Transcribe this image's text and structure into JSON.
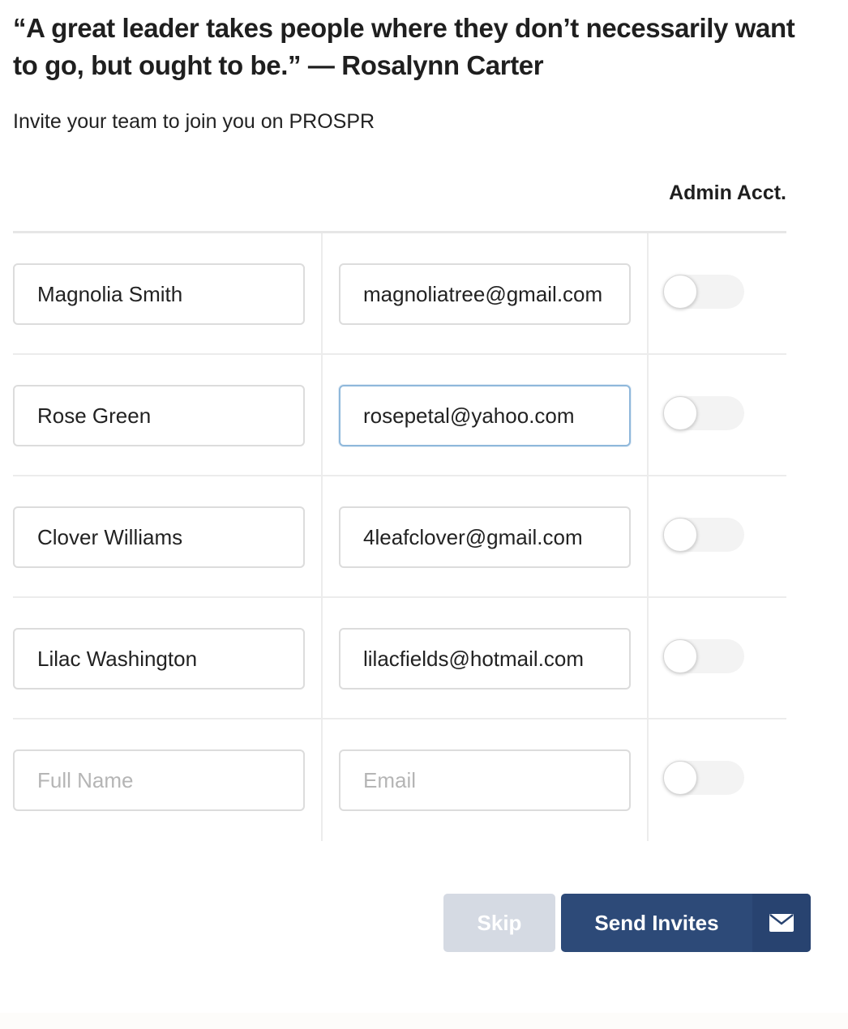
{
  "quote": "“A great leader takes people where they don’t necessarily want to go, but ought to be.” — Rosalynn Carter",
  "subtitle": "Invite your team to join you on PROSPR",
  "table": {
    "admin_header": "Admin Acct.",
    "rows": [
      {
        "name": "Magnolia Smith",
        "email": "magnoliatree@gmail.com",
        "admin": false
      },
      {
        "name": "Rose Green",
        "email": "rosepetal@yahoo.com",
        "admin": false
      },
      {
        "name": "Clover Williams",
        "email": "4leafclover@gmail.com",
        "admin": false
      },
      {
        "name": "Lilac Washington",
        "email": "lilacfields@hotmail.com",
        "admin": false
      },
      {
        "name": "",
        "email": "",
        "admin": false
      }
    ],
    "name_placeholder": "Full Name",
    "email_placeholder": "Email"
  },
  "actions": {
    "skip_label": "Skip",
    "send_label": "Send Invites",
    "send_icon": "envelope-icon"
  },
  "colors": {
    "primary": "#2d4a78",
    "skip_bg": "#d5dae3",
    "focus_border": "#8fb8db"
  }
}
